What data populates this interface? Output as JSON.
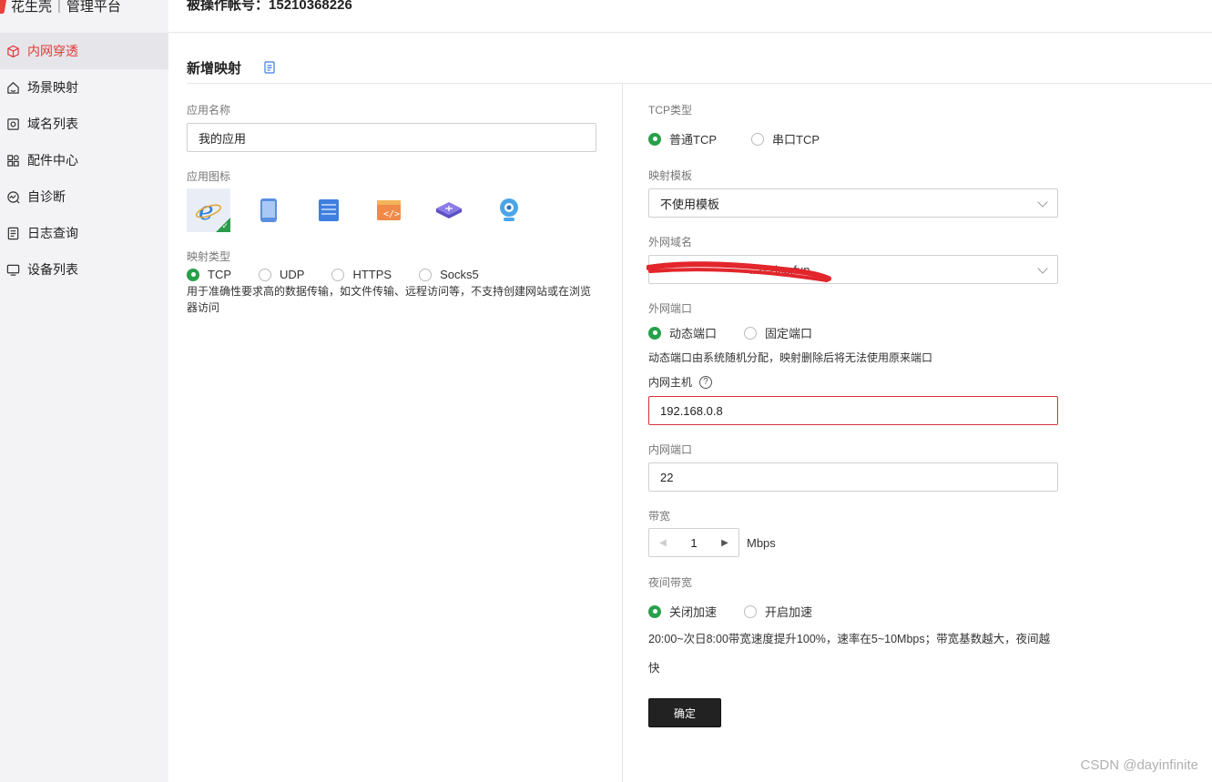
{
  "brand": {
    "name": "花生壳",
    "platform": "管理平台"
  },
  "operator": {
    "label": "被操作帐号：",
    "account": "15210368226"
  },
  "sidebar": {
    "items": [
      {
        "label": "内网穿透",
        "icon": "cube-icon",
        "active": true
      },
      {
        "label": "场景映射",
        "icon": "home-icon"
      },
      {
        "label": "域名列表",
        "icon": "domain-icon"
      },
      {
        "label": "配件中心",
        "icon": "grid-icon"
      },
      {
        "label": "自诊断",
        "icon": "diagnose-icon"
      },
      {
        "label": "日志查询",
        "icon": "log-icon"
      },
      {
        "label": "设备列表",
        "icon": "monitor-icon"
      }
    ]
  },
  "page": {
    "title": "新增映射"
  },
  "form_left": {
    "app_name_label": "应用名称",
    "app_name_value": "我的应用",
    "app_icon_label": "应用图标",
    "app_icons": [
      "ie-icon",
      "tablet-icon",
      "server-icon",
      "code-icon",
      "router-icon",
      "camera-icon"
    ],
    "map_type_label": "映射类型",
    "map_types": [
      "TCP",
      "UDP",
      "HTTPS",
      "Socks5"
    ],
    "map_type_selected": "TCP",
    "map_type_desc": "用于准确性要求高的数据传输，如文件传输、远程访问等，不支持创建网站或在浏览器访问"
  },
  "form_right": {
    "tcp_type_label": "TCP类型",
    "tcp_types": [
      "普通TCP",
      "串口TCP"
    ],
    "template_label": "映射模板",
    "template_value": "不使用模板",
    "domain_label": "外网域名",
    "domain_value": "...0.zicp.fun",
    "ext_port_label": "外网端口",
    "ext_port_options": [
      "动态端口",
      "固定端口"
    ],
    "ext_port_desc": "动态端口由系统随机分配，映射删除后将无法使用原来端口",
    "host_label": "内网主机",
    "host_value": "192.168.0.8",
    "inner_port_label": "内网端口",
    "inner_port_value": "22",
    "bandwidth_label": "带宽",
    "bandwidth_value": "1",
    "bandwidth_unit": "Mbps",
    "night_label": "夜间带宽",
    "night_options": [
      "关闭加速",
      "开启加速"
    ],
    "night_desc_line1": "20:00~次日8:00带宽速度提升100%，速率在5~10Mbps；带宽基数越大，夜间越",
    "night_desc_line2": "快",
    "confirm": "确定"
  },
  "watermark": "CSDN @dayinfinite",
  "colors": {
    "accent_red": "#e23a3a",
    "radio_green": "#27a04a",
    "button_dark": "#222222"
  }
}
